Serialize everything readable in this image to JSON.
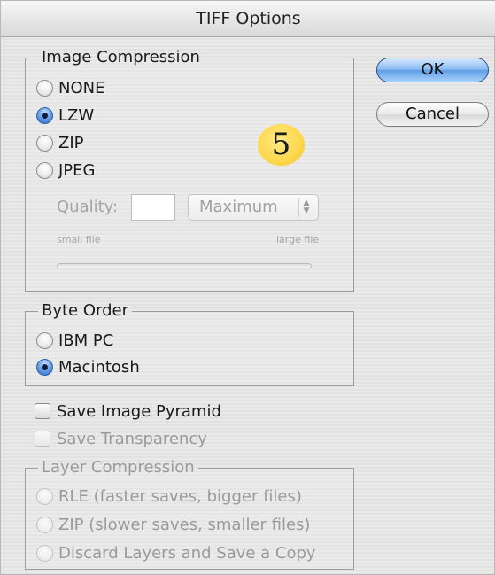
{
  "window": {
    "title": "TIFF Options"
  },
  "buttons": {
    "ok": "OK",
    "cancel": "Cancel"
  },
  "image_compression": {
    "legend": "Image Compression",
    "options": [
      {
        "label": "NONE",
        "selected": false
      },
      {
        "label": "LZW",
        "selected": true
      },
      {
        "label": "ZIP",
        "selected": false
      },
      {
        "label": "JPEG",
        "selected": false
      }
    ],
    "quality": {
      "label": "Quality:",
      "value": "",
      "select_value": "Maximum",
      "small_label": "small file",
      "large_label": "large file"
    }
  },
  "callout": {
    "number": "5"
  },
  "byte_order": {
    "legend": "Byte Order",
    "options": [
      {
        "label": "IBM PC",
        "selected": false
      },
      {
        "label": "Macintosh",
        "selected": true
      }
    ]
  },
  "checkboxes": {
    "save_image_pyramid": {
      "label": "Save Image Pyramid",
      "checked": false,
      "enabled": true
    },
    "save_transparency": {
      "label": "Save Transparency",
      "checked": false,
      "enabled": false
    }
  },
  "layer_compression": {
    "legend": "Layer Compression",
    "options": [
      {
        "label": "RLE (faster saves, bigger files)",
        "selected": false
      },
      {
        "label": "ZIP (slower saves, smaller files)",
        "selected": false
      },
      {
        "label": "Discard Layers and Save a Copy",
        "selected": false
      }
    ]
  },
  "colors": {
    "accent_blue": "#5f9fe6",
    "callout_yellow": "#fdd84a",
    "disabled_text": "#9a9a9a"
  }
}
